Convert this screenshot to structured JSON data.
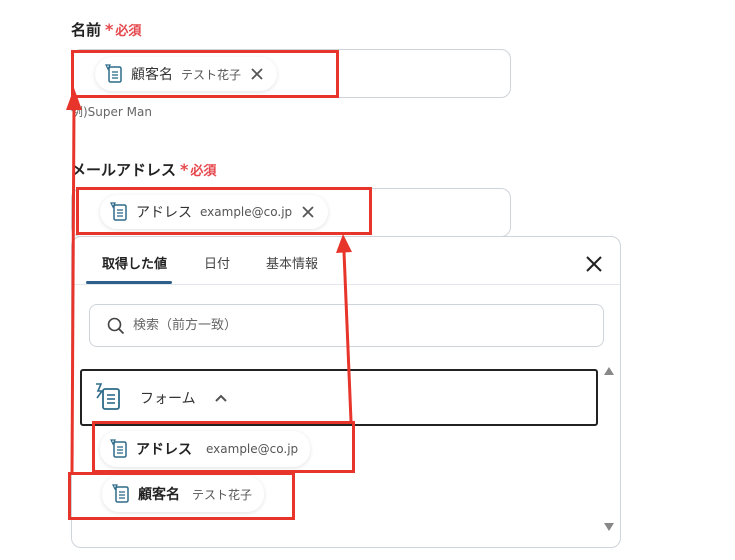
{
  "form": {
    "name_field": {
      "label": "名前",
      "required": "必須",
      "hint": "例)Super Man",
      "chip": {
        "name": "顧客名",
        "value": "テスト花子"
      }
    },
    "email_field": {
      "label": "メールアドレス",
      "required": "必須",
      "chip": {
        "name": "アドレス",
        "value": "example@co.jp"
      }
    }
  },
  "picker": {
    "tabs": [
      {
        "label": "取得した値",
        "active": true
      },
      {
        "label": "日付",
        "active": false
      },
      {
        "label": "基本情報",
        "active": false
      }
    ],
    "search": {
      "placeholder": "検索（前方一致）",
      "value": ""
    },
    "section": {
      "title": "フォーム",
      "expanded": true
    },
    "items": [
      {
        "name": "アドレス",
        "value": "example@co.jp"
      },
      {
        "name": "顧客名",
        "value": "テスト花子"
      }
    ]
  },
  "colors": {
    "required": "#e5484d",
    "annotation": "#e8352b",
    "tab_accent": "#2e5f8a",
    "icon": "#2e6b8a"
  },
  "icons": {
    "field_value": "form-field-icon",
    "remove": "close-icon",
    "search": "search-icon",
    "collapse": "chevron-up-icon",
    "section": "form-trigger-icon"
  }
}
